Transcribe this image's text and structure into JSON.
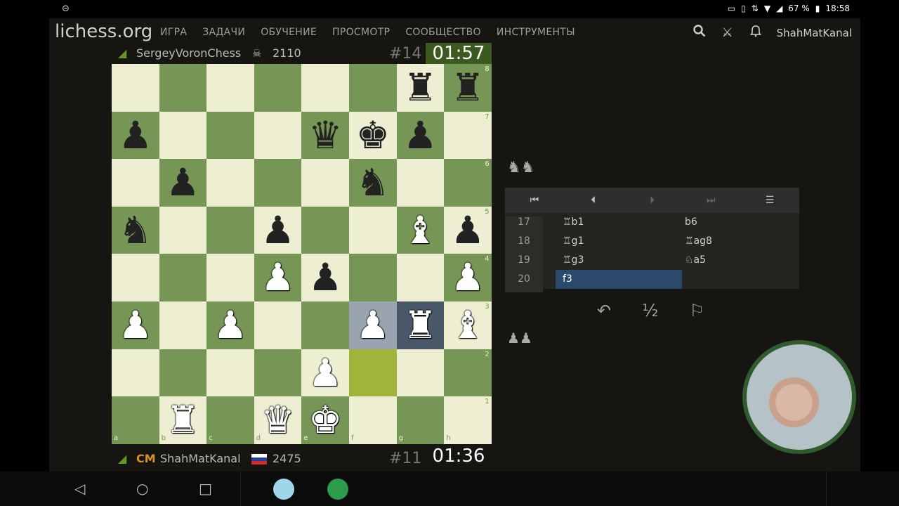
{
  "status_bar": {
    "battery_percent": "67 %",
    "time": "18:58"
  },
  "site": {
    "logo": "lichess.org",
    "nav": [
      "ИГРА",
      "ЗАДАЧИ",
      "ОБУЧЕНИЕ",
      "ПРОСМОТР",
      "СООБЩЕСТВО",
      "ИНСТРУМЕНТЫ"
    ],
    "username": "ShahMatKanal"
  },
  "opponent": {
    "name": "SergeyVoronChess",
    "rating": "2110",
    "number": "#14",
    "clock": "01:57"
  },
  "player": {
    "title": "CM",
    "name": "ShahMatKanal",
    "rating": "2475",
    "number": "#11",
    "clock": "01:36"
  },
  "board": {
    "files": [
      "a",
      "b",
      "c",
      "d",
      "e",
      "f",
      "g",
      "h"
    ],
    "ranks": [
      "8",
      "7",
      "6",
      "5",
      "4",
      "3",
      "2",
      "1"
    ],
    "colors": {
      "light": "#eeeed2",
      "dark": "#769656"
    }
  },
  "moves": [
    {
      "num": "17",
      "white": "♖b1",
      "black": "b6"
    },
    {
      "num": "18",
      "white": "♖g1",
      "black": "♖ag8"
    },
    {
      "num": "19",
      "white": "♖g3",
      "black": "♘a5"
    },
    {
      "num": "20",
      "white": "f3",
      "black": ""
    }
  ],
  "material": {
    "top": "♞♞",
    "bottom": "♟♟"
  },
  "actions": {
    "takeback": "↶",
    "draw": "½",
    "resign": "⚐"
  }
}
